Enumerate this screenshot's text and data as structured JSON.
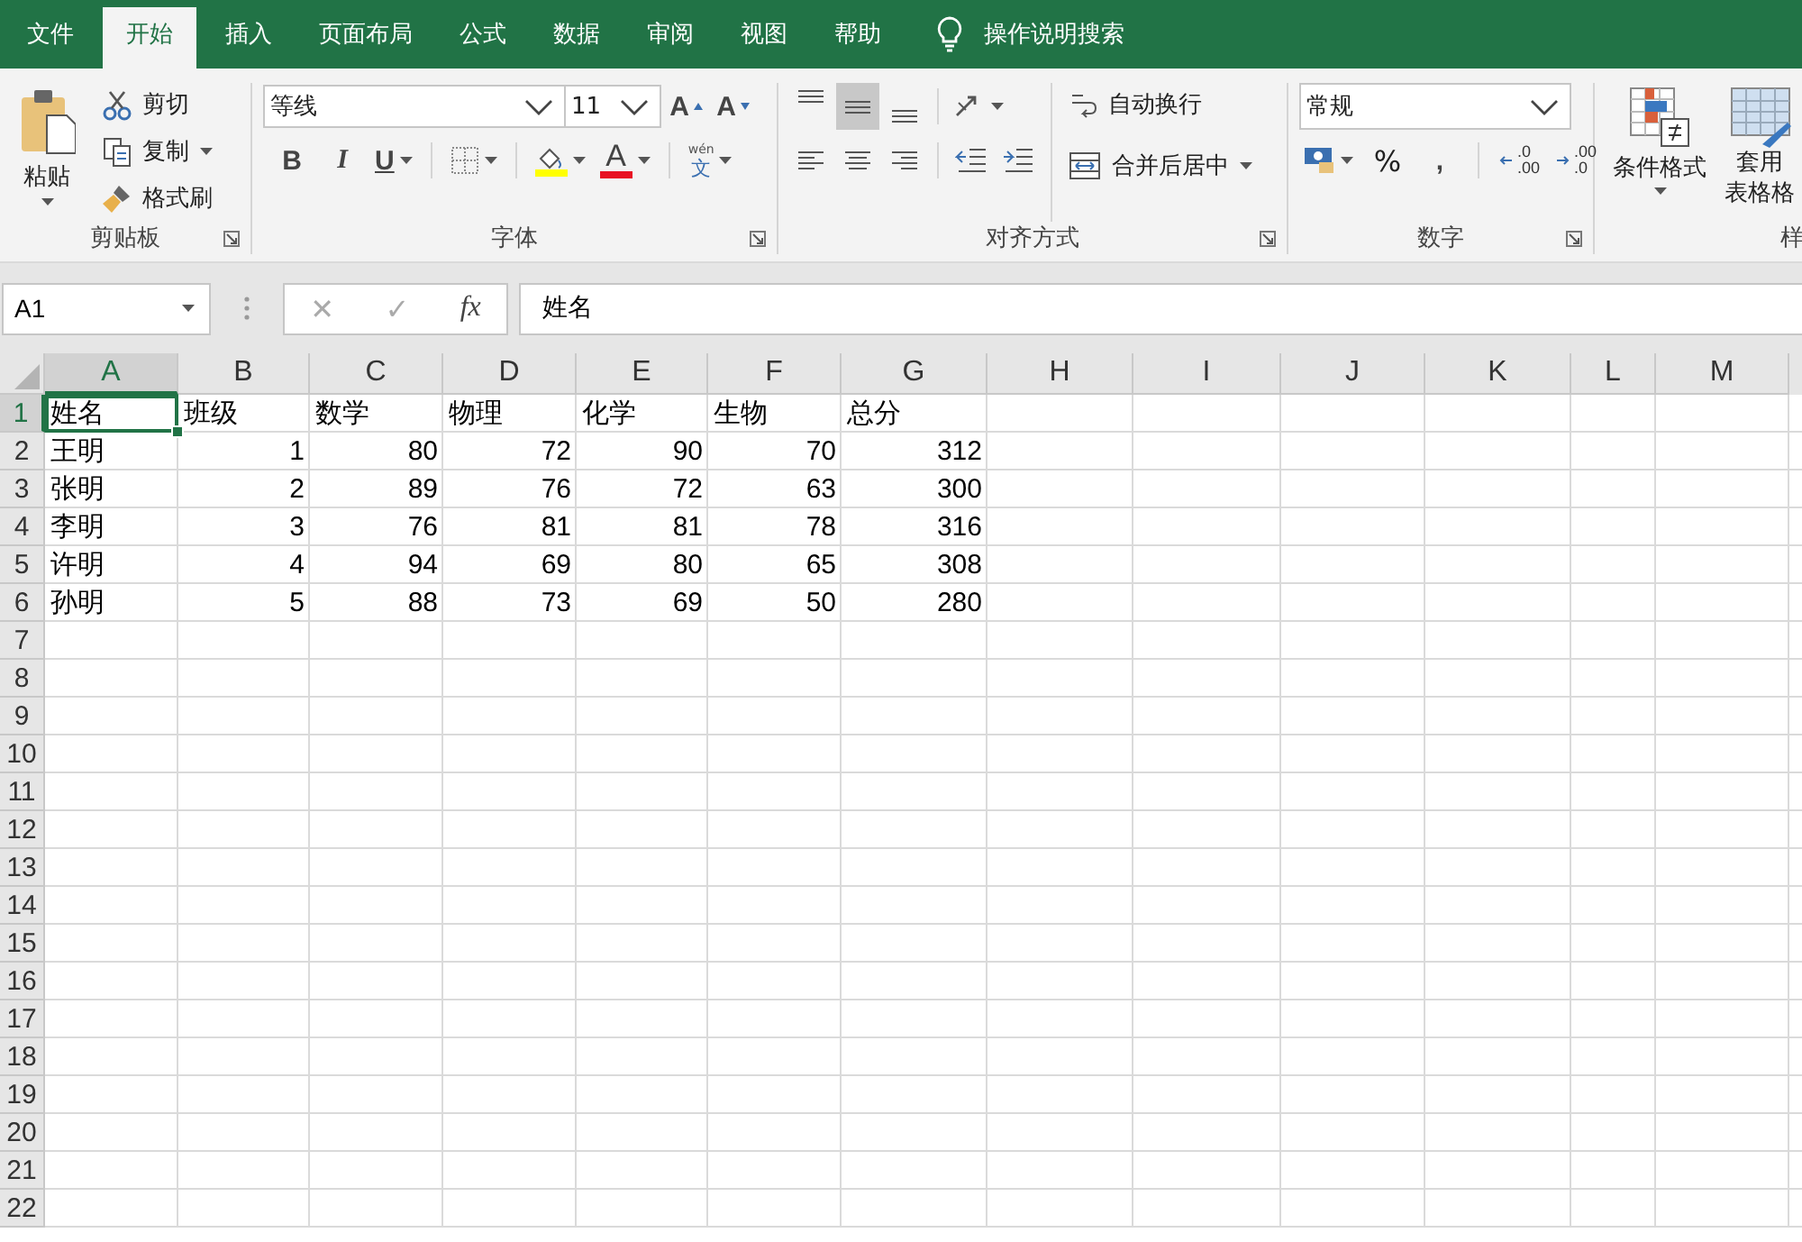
{
  "ribbon_tabs": [
    {
      "label": "文件",
      "selected": false
    },
    {
      "label": "开始",
      "selected": true
    },
    {
      "label": "插入",
      "selected": false
    },
    {
      "label": "页面布局",
      "selected": false
    },
    {
      "label": "公式",
      "selected": false
    },
    {
      "label": "数据",
      "selected": false
    },
    {
      "label": "审阅",
      "selected": false
    },
    {
      "label": "视图",
      "selected": false
    },
    {
      "label": "帮助",
      "selected": false
    }
  ],
  "tell_me": "操作说明搜索",
  "clipboard": {
    "paste": "粘贴",
    "cut": "剪切",
    "copy": "复制",
    "format_painter": "格式刷",
    "label": "剪贴板"
  },
  "font": {
    "name": "等线",
    "size": "11",
    "grow": "A",
    "shrink": "A",
    "bold": "B",
    "italic": "I",
    "underline": "U",
    "font_color": "A",
    "phonetic_pinyin": "wén",
    "phonetic_char": "文",
    "label": "字体"
  },
  "alignment": {
    "vertical_align": [
      {
        "selected": false
      },
      {
        "selected": true
      },
      {
        "selected": false
      }
    ],
    "horizontal_align": [
      {
        "selected": false
      },
      {
        "selected": false
      },
      {
        "selected": false
      }
    ],
    "wrap_text": "自动换行",
    "merge_center": "合并后居中",
    "label": "对齐方式"
  },
  "number": {
    "format": "常规",
    "percent": "%",
    "comma": ",",
    "increase_decimal": [
      ".0",
      ".00"
    ],
    "decrease_decimal": [
      ".00",
      ".0"
    ],
    "label": "数字"
  },
  "styles": {
    "conditional_format": "条件格式",
    "format_as_table": [
      "套用",
      "表格格"
    ],
    "label": "样"
  },
  "formula_bar": {
    "name_box": "A1",
    "cancel": "✕",
    "enter": "✓",
    "fx": "fx",
    "value": "姓名"
  },
  "sheet": {
    "columns": [
      {
        "label": "A",
        "selected": true
      },
      {
        "label": "B",
        "selected": false
      },
      {
        "label": "C",
        "selected": false
      },
      {
        "label": "D",
        "selected": false
      },
      {
        "label": "E",
        "selected": false
      },
      {
        "label": "F",
        "selected": false
      },
      {
        "label": "G",
        "selected": false
      },
      {
        "label": "H",
        "selected": false
      },
      {
        "label": "I",
        "selected": false
      },
      {
        "label": "J",
        "selected": false
      },
      {
        "label": "K",
        "selected": false
      },
      {
        "label": "L",
        "selected": false
      },
      {
        "label": "M",
        "selected": false
      }
    ],
    "row_numbers": [
      {
        "label": "1",
        "selected": true
      },
      {
        "label": "2",
        "selected": false
      },
      {
        "label": "3",
        "selected": false
      },
      {
        "label": "4",
        "selected": false
      },
      {
        "label": "5",
        "selected": false
      },
      {
        "label": "6",
        "selected": false
      },
      {
        "label": "7",
        "selected": false
      },
      {
        "label": "8",
        "selected": false
      },
      {
        "label": "9",
        "selected": false
      },
      {
        "label": "10",
        "selected": false
      },
      {
        "label": "11",
        "selected": false
      },
      {
        "label": "12",
        "selected": false
      },
      {
        "label": "13",
        "selected": false
      },
      {
        "label": "14",
        "selected": false
      },
      {
        "label": "15",
        "selected": false
      },
      {
        "label": "16",
        "selected": false
      },
      {
        "label": "17",
        "selected": false
      },
      {
        "label": "18",
        "selected": false
      },
      {
        "label": "19",
        "selected": false
      },
      {
        "label": "20",
        "selected": false
      },
      {
        "label": "21",
        "selected": false
      },
      {
        "label": "22",
        "selected": false
      }
    ],
    "header_row": [
      "姓名",
      "班级",
      "数学",
      "物理",
      "化学",
      "生物",
      "总分"
    ],
    "rows": [
      [
        "王明",
        "1",
        "80",
        "72",
        "90",
        "70",
        "312"
      ],
      [
        "张明",
        "2",
        "89",
        "76",
        "72",
        "63",
        "300"
      ],
      [
        "李明",
        "3",
        "76",
        "81",
        "81",
        "78",
        "316"
      ],
      [
        "许明",
        "4",
        "94",
        "69",
        "80",
        "65",
        "308"
      ],
      [
        "孙明",
        "5",
        "88",
        "73",
        "69",
        "50",
        "280"
      ]
    ]
  }
}
